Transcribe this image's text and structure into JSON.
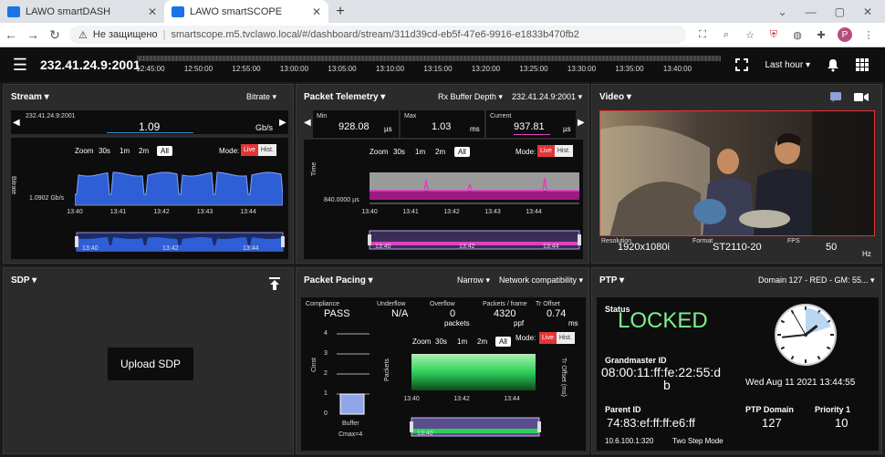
{
  "browser": {
    "tabs": [
      {
        "title": "LAWO smartDASH",
        "active": false
      },
      {
        "title": "LAWO smartSCOPE",
        "active": true
      }
    ],
    "security": "Не защищено",
    "url": "smartscope.m5.tvclawo.local/#/dashboard/stream/311d39cd-eb5f-47e6-9916-e1833b470fb2",
    "profile_initial": "P"
  },
  "header": {
    "stream": "232.41.24.9:2001",
    "timeline": [
      "12:45:00",
      "12:50:00",
      "12:55:00",
      "13:00:00",
      "13:05:00",
      "13:10:00",
      "13:15:00",
      "13:20:00",
      "13:25:00",
      "13:30:00",
      "13:35:00",
      "13:40:00"
    ],
    "range": "Last hour"
  },
  "stream_panel": {
    "title": "Stream",
    "metric": "Bitrate",
    "source": "232.41.24.9:2001",
    "value": "1.09",
    "unit": "Gb/s",
    "zoom_label": "Zoom",
    "zoom": [
      "30s",
      "1m",
      "2m",
      "All"
    ],
    "mode_label": "Mode:",
    "live": "Live",
    "hist": "Hist.",
    "y_axis": "Bitrate",
    "y_value": "1.0902 Gb/s",
    "x_ticks": [
      "13:40",
      "13:41",
      "13:42",
      "13:43",
      "13:44"
    ],
    "nav_ticks": [
      "13:40",
      "13:42",
      "13:44"
    ]
  },
  "telemetry_panel": {
    "title": "Packet Telemetry",
    "metric": "Rx Buffer Depth",
    "source": "232.41.24.9:2001",
    "min_label": "Min",
    "min": "928.08",
    "max_label": "Max",
    "max": "1.03",
    "current_label": "Current",
    "current": "937.81",
    "min_unit": "µs",
    "max_unit": "ms",
    "current_unit": "µs",
    "zoom_label": "Zoom",
    "zoom": [
      "30s",
      "1m",
      "2m",
      "All"
    ],
    "mode_label": "Mode:",
    "live": "Live",
    "hist": "Hist.",
    "y_axis": "Time",
    "y_value": "840.0000 µs",
    "x_ticks": [
      "13:40",
      "13:41",
      "13:42",
      "13:43",
      "13:44"
    ],
    "nav_ticks": [
      "13:40",
      "13:42",
      "13:44"
    ]
  },
  "video_panel": {
    "title": "Video",
    "resolution_label": "Resolution",
    "resolution": "1920x1080i",
    "format_label": "Format",
    "format": "ST2110-20",
    "fps_label": "FPS",
    "fps": "50",
    "fps_unit": "Hz"
  },
  "sdp_panel": {
    "title": "SDP",
    "upload": "Upload SDP"
  },
  "pacing_panel": {
    "title": "Packet Pacing",
    "narrow": "Narrow",
    "compat": "Network compatibility",
    "compliance_label": "Compliance",
    "compliance": "PASS",
    "underflow_label": "Underflow",
    "underflow": "N/A",
    "overflow_label": "Overflow",
    "overflow": "0",
    "overflow_unit": "packets",
    "ppf_label": "Packets / frame",
    "ppf": "4320",
    "ppf_unit": "ppf",
    "tro_label": "Tr Offset",
    "tro": "0.74",
    "tro_unit": "ms",
    "zoom_label": "Zoom",
    "zoom": [
      "30s",
      "1m",
      "2m",
      "All"
    ],
    "mode_label": "Mode:",
    "live": "Live",
    "hist": "Hist.",
    "cinst_label": "Cinst",
    "cinst_ticks": [
      "4",
      "3",
      "2",
      "1",
      "0"
    ],
    "buffer_label": "Buffer",
    "cmax": "Cmax=4",
    "packets_label": "Packets",
    "tro_axis": "Tr Offset (ms)",
    "x_ticks": [
      "13:40",
      "13:42",
      "13:44"
    ],
    "nav_ticks": [
      "13:40"
    ]
  },
  "ptp_panel": {
    "title": "PTP",
    "domain": "Domain 127 - RED - GM: 55...",
    "status_label": "Status",
    "status": "LOCKED",
    "gm_label": "Grandmaster ID",
    "gm_line1": "08:00:11:ff:fe:22:55:d",
    "gm_line2": "b",
    "datetime": "Wed Aug 11 2021 13:44:55",
    "parent_label": "Parent ID",
    "parent": "74:83:ef:ff:ff:e6:ff",
    "ptp_domain_label": "PTP Domain",
    "ptp_domain": "127",
    "priority_label": "Priority 1",
    "priority": "10",
    "addr": "10.6.100.1:320",
    "step": "Two Step Mode"
  },
  "colors": {
    "accent_red": "#e23636",
    "bitrate_blue": "#2f5fd6",
    "telemetry_pink": "#e23fc4",
    "pacing_green": "#2fd05a",
    "locked_green": "#7cf08a"
  }
}
